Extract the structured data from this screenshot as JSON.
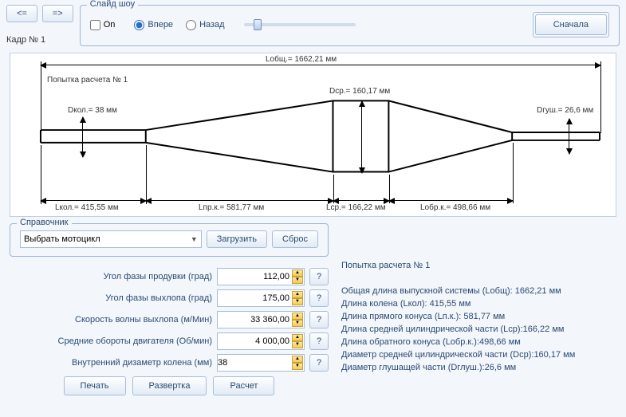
{
  "nav": {
    "prev": "<=",
    "next": "=>",
    "frame_label": "Кадр № 1"
  },
  "slideshow": {
    "title": "Слайд шоу",
    "on_label": "On",
    "forward_label": "Впере",
    "backward_label": "Назад",
    "restart_label": "Сначала"
  },
  "diagram": {
    "attempt": "Попытка расчета № 1",
    "L_total": "Lобщ.= 1662,21 мм",
    "D_col": "Dкол.= 38 мм",
    "D_cp": "Dср.= 160,17 мм",
    "D_gush": "Dгуш.= 26,6 мм",
    "L_col": "Lкол.= 415,55 мм",
    "L_prk": "Lпр.к.= 581,77 мм",
    "L_cp": "Lср.= 166,22 мм",
    "L_obrk": "Lобр.к.= 498,66 мм"
  },
  "reference": {
    "title": "Справочник",
    "select_placeholder": "Выбрать мотоцикл",
    "load": "Загрузить",
    "reset": "Сброс"
  },
  "inputs": {
    "purge": {
      "label": "Угол фазы продувки (град)",
      "value": "112,00"
    },
    "exhaust": {
      "label": "Угол фазы выхлопа (град)",
      "value": "175,00"
    },
    "wave": {
      "label": "Скорость волны выхлопа (м/Мин)",
      "value": "33 360,00"
    },
    "rpm": {
      "label": "Средние обороты двигателя (Об/мин)",
      "value": "4 000,00"
    },
    "dia": {
      "label": "Внутренний дизаметр колена (мм)",
      "value": "38"
    }
  },
  "buttons": {
    "print": "Печать",
    "unfold": "Развертка",
    "calc": "Расчет",
    "help": "?"
  },
  "results": {
    "title": "Попытка расчета № 1",
    "l1": "Общая длина выпускной системы (Lобщ): 1662,21 мм",
    "l2": "Длина колена (Lкол): 415,55 мм",
    "l3": "Длина прямого конуса (Lп.к.): 581,77 мм",
    "l4": "Длина средней цилиндрической части (Lср):166,22 мм",
    "l5": "Длина обратного конуса (Lобр.к.):498,66 мм",
    "l6": "Диаметр средней цилиндрической части (Dср):160,17 мм",
    "l7": "Диаметр глушащей части (Dглуш.):26,6 мм"
  }
}
